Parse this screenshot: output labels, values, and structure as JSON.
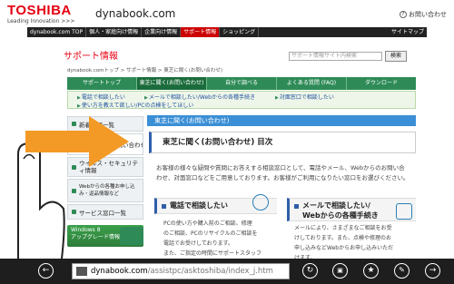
{
  "header": {
    "brand": "TOSHIBA",
    "tagline": "Leading Innovation >>>",
    "site_name": "dynabook.com",
    "contact_link": "お問い合わせ"
  },
  "top_nav": {
    "items": [
      "dynabook.com TOP",
      "個人・家庭向け情報",
      "企業向け情報",
      "サポート情報",
      "ショッピング"
    ],
    "active_index": 3,
    "sitemap": "サイトマップ"
  },
  "section": {
    "title": "サポート情報",
    "search_placeholder": "サポート情報サイト内検索",
    "search_button": "検索",
    "breadcrumb": "dynabook.comトップ > サポート情報 > 東芝に聞く(お問い合わせ)"
  },
  "tabs": {
    "items": [
      "サポートトップ",
      "東芝に聞く(お問い合わせ)",
      "自分で調べる",
      "よくある質問 (FAQ)",
      "ダウンロード"
    ],
    "active_index": 1
  },
  "subnav": {
    "links": [
      "電話で相談したい",
      "メールで相談したい/Webからの各種手続き",
      "対面窓口で相談したい",
      "使い方を教えて欲しい/PCの点検をしてほしい"
    ]
  },
  "sidebar": {
    "items": [
      "新着情報一覧",
      "東芝に聞く(お問い合わせ)",
      "ウイルス・セキュリティ情報",
      "Webからの各種お申し込み・返品情報など",
      "サービス窓口一覧"
    ],
    "banner_line1": "Windows 8",
    "banner_line2": "アップグレード情報"
  },
  "main": {
    "blue_bar": "東芝に聞く(お問い合わせ)",
    "title": "東芝に聞く(お問い合わせ) 目次",
    "intro_line1": "お客様の様々な疑問や質問にお答えする相談窓口として、電話やメール、Webからのお問い合",
    "intro_line2": "わせ、対面窓口などをご用意しております。お客様がご利用になりたい窓口をお選びください。",
    "card_phone": {
      "title": "電話で相談したい",
      "lines": [
        "PCの使い方や購入前のご相談、修理",
        "のご相談、PCのリサイクルのご相談を",
        "電話でお受けしております。",
        "また、ご指定の時間にサポートスタッフ"
      ]
    },
    "card_mail": {
      "title_line1": "メールで相談したい/",
      "title_line2": "Webからの各種手続き",
      "lines": [
        "メールにより、さまざまなご相談をお受",
        "けしております。また、点検や修理のお",
        "申し込みなどWebからお申し込みいただ",
        "けます。"
      ]
    }
  },
  "browser": {
    "url_domain": "dynabook.com",
    "url_path": "/assistpc/asktoshiba/index_j.htm"
  },
  "colors": {
    "brand_red": "#e60012",
    "tab_green": "#2e8b57",
    "heading_blue": "#3b8fd6",
    "arrow_orange": "#f39a26"
  }
}
